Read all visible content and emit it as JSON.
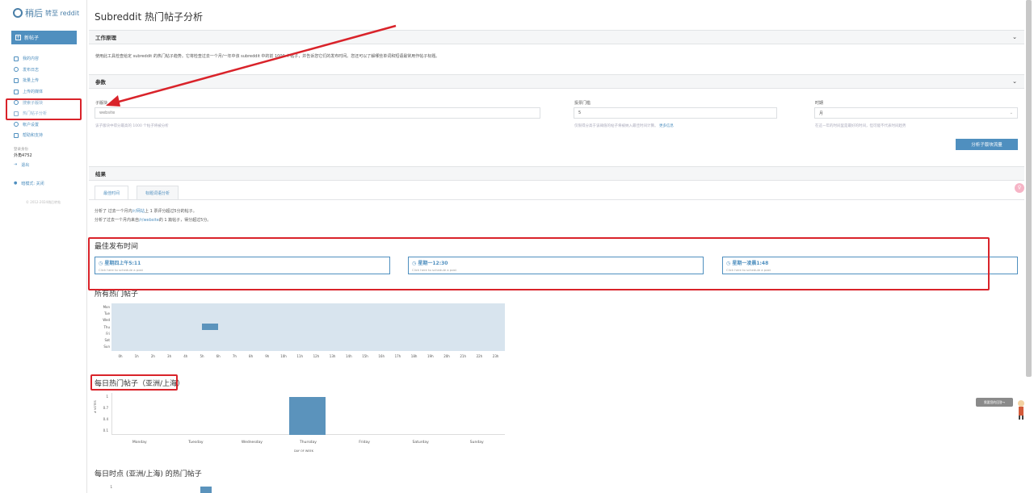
{
  "logo": {
    "brand": "稍后",
    "suffix": "转至 reddit"
  },
  "sidebar": {
    "new_post": "新帖子",
    "items": [
      {
        "label": "我的内容"
      },
      {
        "label": "发布日志"
      },
      {
        "label": "批量上传"
      },
      {
        "label": "上传的媒体"
      },
      {
        "label": "搜索子版块"
      },
      {
        "label": "热门帖子分析"
      },
      {
        "label": "帐户设置"
      },
      {
        "label": "帮助和支持"
      }
    ],
    "account_label": "登录身份",
    "user": "外角4752",
    "logout": "退出",
    "night_mode": "暗模式: 关闭",
    "copyright": "© 2012-2024稍后转帖"
  },
  "page": {
    "title": "Subreddit 热门帖子分析"
  },
  "how_it_works": {
    "heading": "工作原理",
    "description": "使用此工具检查给定 subreddit 的热门帖子趋势。它将检查过去一个月/一年中该 subreddit 中的前 1000 个帖子，并告诉您它们的发布时间。您还可以了解哪些单词和短语最常用作帖子标题。"
  },
  "params": {
    "heading": "参数",
    "subreddit_label": "子版块",
    "subreddit_value": "website",
    "subreddit_hint": "该子版块中得分最高的 1000 个帖子将被分析",
    "score_label": "投票门槛",
    "score_value": "5",
    "score_hint": "仅限得分高于该阈值的帖子将被纳入最佳时间计算。",
    "score_hint_link": "更多信息",
    "period_label": "时期",
    "period_value": "月",
    "period_hint": "在这一年的时间里是最好的时间，但可能不代表时间趋势",
    "analyze_button": "分析子版块流量"
  },
  "results": {
    "heading": "结果",
    "tabs": [
      "最佳时间",
      "标题词语分析"
    ],
    "summary_1_prefix": "分析了 过去一个月内",
    "summary_1_link": "/r/网站",
    "summary_1_suffix": "上 1 票评分超过5分的帖子。",
    "summary_2_prefix": "分析了过去一个月内来自",
    "summary_2_link": "/r/website",
    "summary_2_suffix": "的 1 篇帖子，得分超过5分。",
    "best_time_title": "最佳发布时间",
    "best_times": [
      {
        "time": "星期四上午5:11",
        "sub": "Click here to schedule a post"
      },
      {
        "time": "星期一12:30",
        "sub": "Click here to schedule a post"
      },
      {
        "time": "星期一凌晨1:48",
        "sub": "Click here to schedule a post"
      }
    ],
    "all_hot_title": "所有热门帖子",
    "daily_title": "每日热门帖子（亚洲/上海）",
    "hourly_title": "每日时点 (亚洲/上海) 的热门帖子"
  },
  "chart_data": [
    {
      "type": "heatmap",
      "title": "所有热门帖子",
      "y_categories": [
        "Mon",
        "Tue",
        "Wed",
        "Thu",
        "Fri",
        "Sat",
        "Sun"
      ],
      "x_categories": [
        "0h",
        "1h",
        "2h",
        "3h",
        "4h",
        "5h",
        "6h",
        "7h",
        "8h",
        "9h",
        "10h",
        "11h",
        "12h",
        "13h",
        "14h",
        "15h",
        "16h",
        "17h",
        "18h",
        "19h",
        "20h",
        "21h",
        "22h",
        "23h"
      ],
      "cells": [
        {
          "x": "5h",
          "y": "Thu",
          "value": 1
        }
      ]
    },
    {
      "type": "bar",
      "title": "每日热门帖子（亚洲/上海）",
      "categories": [
        "Monday",
        "Tuesday",
        "Wednesday",
        "Thursday",
        "Friday",
        "Saturday",
        "Sunday"
      ],
      "values": [
        0,
        0,
        0,
        1,
        0,
        0,
        0
      ],
      "xlabel": "DAY OF WEEK",
      "ylabel": "# VOTES",
      "yticks": [
        "1",
        "0.7",
        "0.4",
        "0.1"
      ],
      "ylim": [
        0,
        1
      ]
    }
  ],
  "widgets": {
    "float_pill": "需要您的回答→",
    "pink_badge": "♀"
  }
}
